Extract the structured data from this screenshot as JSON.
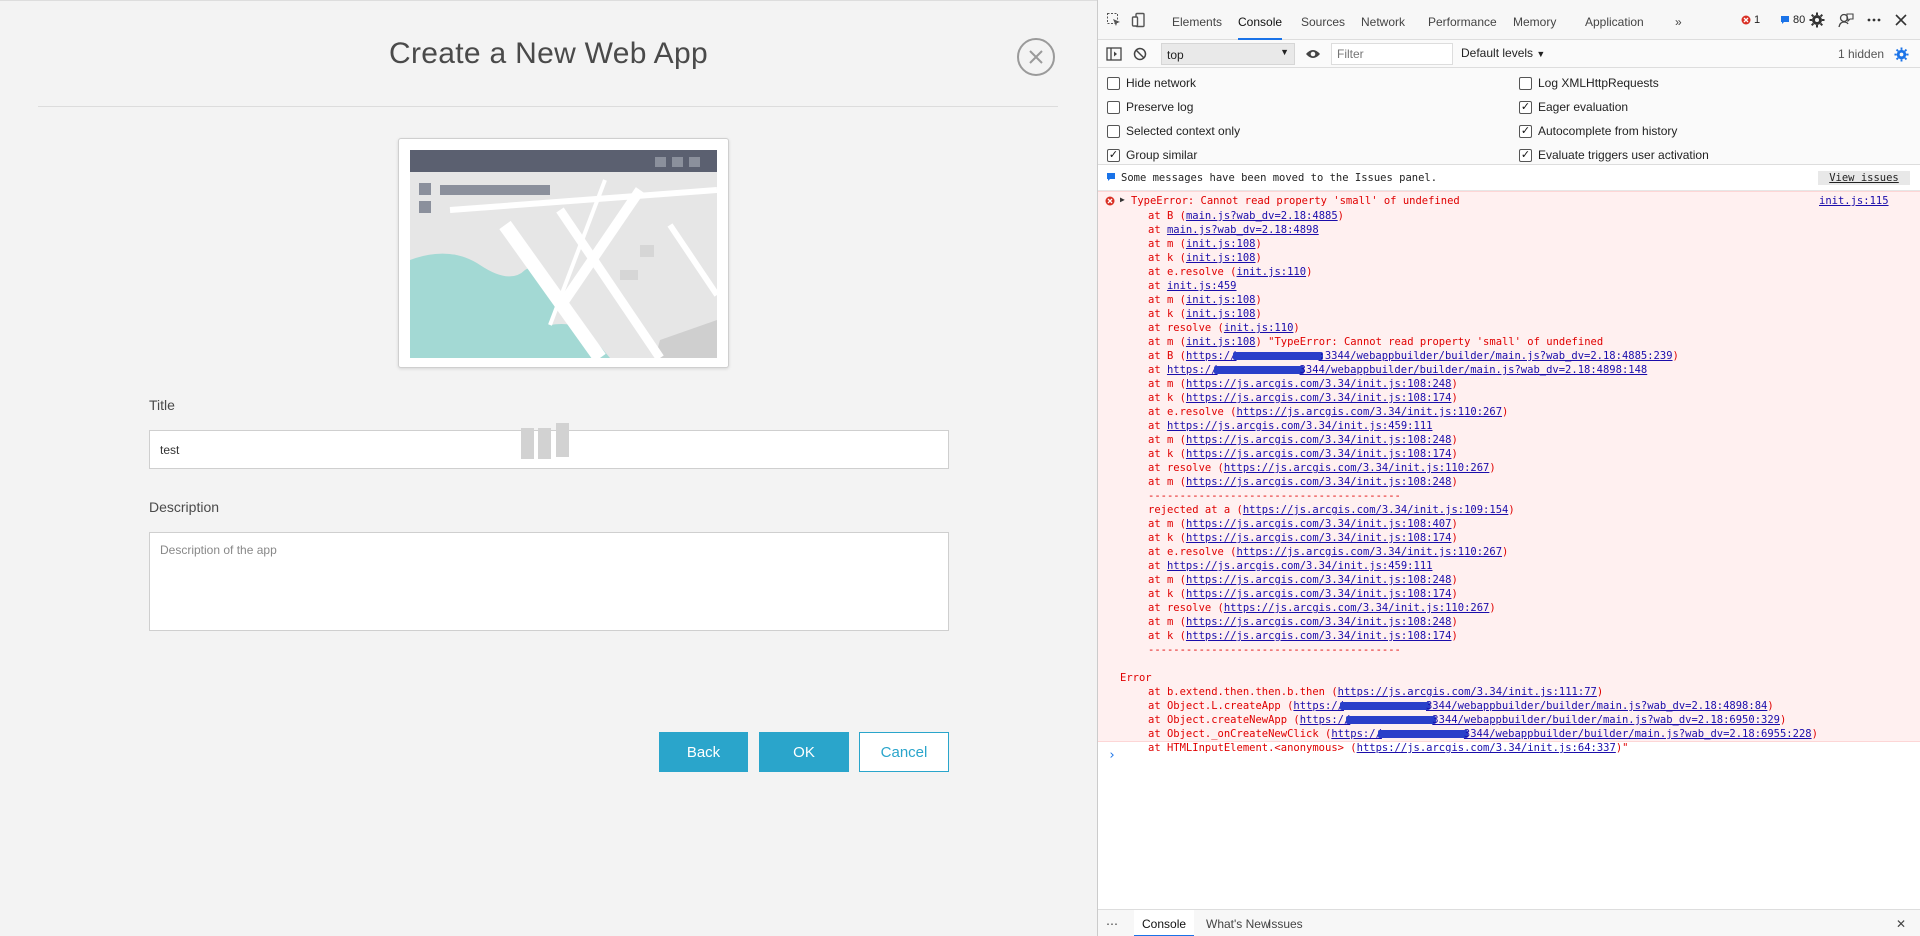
{
  "app": {
    "title": "Create a New Web App",
    "title_label": "Title",
    "title_value": "test",
    "description_label": "Description",
    "description_placeholder": "Description of the app",
    "buttons": {
      "back": "Back",
      "ok": "OK",
      "cancel": "Cancel"
    },
    "accent_color": "#2aa5cb"
  },
  "devtools": {
    "tabs": [
      {
        "label": "Elements",
        "active": false
      },
      {
        "label": "Console",
        "active": true
      },
      {
        "label": "Sources",
        "active": false
      },
      {
        "label": "Network",
        "active": false
      },
      {
        "label": "Performance",
        "active": false
      },
      {
        "label": "Memory",
        "active": false
      },
      {
        "label": "Application",
        "active": false
      }
    ],
    "more_tabs": "»",
    "error_count": "1",
    "message_count": "80",
    "context": "top",
    "filter_placeholder": "Filter",
    "levels": "Default levels",
    "hidden": "1 hidden",
    "settings": {
      "left": [
        {
          "label": "Hide network",
          "checked": false
        },
        {
          "label": "Preserve log",
          "checked": false
        },
        {
          "label": "Selected context only",
          "checked": false
        },
        {
          "label": "Group similar",
          "checked": true
        }
      ],
      "right": [
        {
          "label": "Log XMLHttpRequests",
          "checked": false
        },
        {
          "label": "Eager evaluation",
          "checked": true
        },
        {
          "label": "Autocomplete from history",
          "checked": true
        },
        {
          "label": "Evaluate triggers user activation",
          "checked": true
        }
      ]
    },
    "info_message": "Some messages have been moved to the Issues panel.",
    "view_issues": "View issues",
    "error_head": "TypeError: Cannot read property 'small' of undefined",
    "error_source": "init.js:115",
    "stack": [
      {
        "indent": 1,
        "pre": "at B (",
        "link": "main.js?wab_dv=2.18:4885",
        "post": ")"
      },
      {
        "indent": 1,
        "pre": "at ",
        "link": "main.js?wab_dv=2.18:4898",
        "post": ""
      },
      {
        "indent": 1,
        "pre": "at m (",
        "link": "init.js:108",
        "post": ")"
      },
      {
        "indent": 1,
        "pre": "at k (",
        "link": "init.js:108",
        "post": ")"
      },
      {
        "indent": 1,
        "pre": "at e.resolve (",
        "link": "init.js:110",
        "post": ")"
      },
      {
        "indent": 1,
        "pre": "at ",
        "link": "init.js:459",
        "post": ""
      },
      {
        "indent": 1,
        "pre": "at m (",
        "link": "init.js:108",
        "post": ")"
      },
      {
        "indent": 1,
        "pre": "at k (",
        "link": "init.js:108",
        "post": ")"
      },
      {
        "indent": 1,
        "pre": "at resolve (",
        "link": "init.js:110",
        "post": ")"
      },
      {
        "indent": 1,
        "pre": "at m (",
        "link": "init.js:108",
        "post": ") \"TypeError: Cannot read property 'small' of undefined"
      },
      {
        "indent": 1,
        "pre": "at B (",
        "link": "https://",
        "redact": true,
        "link2": ":3344/webappbuilder/builder/main.js?wab_dv=2.18:4885:239",
        "post": ")"
      },
      {
        "indent": 1,
        "pre": "at ",
        "link": "https://",
        "redact": true,
        "link2": "3344/webappbuilder/builder/main.js?wab_dv=2.18:4898:148",
        "post": ""
      },
      {
        "indent": 1,
        "pre": "at m (",
        "link": "https://js.arcgis.com/3.34/init.js:108:248",
        "post": ")"
      },
      {
        "indent": 1,
        "pre": "at k (",
        "link": "https://js.arcgis.com/3.34/init.js:108:174",
        "post": ")"
      },
      {
        "indent": 1,
        "pre": "at e.resolve (",
        "link": "https://js.arcgis.com/3.34/init.js:110:267",
        "post": ")"
      },
      {
        "indent": 1,
        "pre": "at ",
        "link": "https://js.arcgis.com/3.34/init.js:459:111",
        "post": ""
      },
      {
        "indent": 1,
        "pre": "at m (",
        "link": "https://js.arcgis.com/3.34/init.js:108:248",
        "post": ")"
      },
      {
        "indent": 1,
        "pre": "at k (",
        "link": "https://js.arcgis.com/3.34/init.js:108:174",
        "post": ")"
      },
      {
        "indent": 1,
        "pre": "at resolve (",
        "link": "https://js.arcgis.com/3.34/init.js:110:267",
        "post": ")"
      },
      {
        "indent": 1,
        "pre": "at m (",
        "link": "https://js.arcgis.com/3.34/init.js:108:248",
        "post": ")"
      },
      {
        "indent": 1,
        "pre": "----------------------------------------",
        "link": "",
        "post": ""
      },
      {
        "indent": 1,
        "pre": "rejected at a (",
        "link": "https://js.arcgis.com/3.34/init.js:109:154",
        "post": ")"
      },
      {
        "indent": 1,
        "pre": "at m (",
        "link": "https://js.arcgis.com/3.34/init.js:108:407",
        "post": ")"
      },
      {
        "indent": 1,
        "pre": "at k (",
        "link": "https://js.arcgis.com/3.34/init.js:108:174",
        "post": ")"
      },
      {
        "indent": 1,
        "pre": "at e.resolve (",
        "link": "https://js.arcgis.com/3.34/init.js:110:267",
        "post": ")"
      },
      {
        "indent": 1,
        "pre": "at ",
        "link": "https://js.arcgis.com/3.34/init.js:459:111",
        "post": ""
      },
      {
        "indent": 1,
        "pre": "at m (",
        "link": "https://js.arcgis.com/3.34/init.js:108:248",
        "post": ")"
      },
      {
        "indent": 1,
        "pre": "at k (",
        "link": "https://js.arcgis.com/3.34/init.js:108:174",
        "post": ")"
      },
      {
        "indent": 1,
        "pre": "at resolve (",
        "link": "https://js.arcgis.com/3.34/init.js:110:267",
        "post": ")"
      },
      {
        "indent": 1,
        "pre": "at m (",
        "link": "https://js.arcgis.com/3.34/init.js:108:248",
        "post": ")"
      },
      {
        "indent": 1,
        "pre": "at k (",
        "link": "https://js.arcgis.com/3.34/init.js:108:174",
        "post": ")"
      },
      {
        "indent": 1,
        "pre": "----------------------------------------",
        "link": "",
        "post": ""
      },
      {
        "indent": 0,
        "pre": "",
        "link": "",
        "post": ""
      },
      {
        "indent": 0,
        "pre": "Error",
        "link": "",
        "post": ""
      },
      {
        "indent": 1,
        "pre": "at b.extend.then.then.b.then (",
        "link": "https://js.arcgis.com/3.34/init.js:111:77",
        "post": ")"
      },
      {
        "indent": 1,
        "pre": "at Object.L.createApp (",
        "link": "https://",
        "redact": true,
        "link2": "3344/webappbuilder/builder/main.js?wab_dv=2.18:4898:84",
        "post": ")"
      },
      {
        "indent": 1,
        "pre": "at Object.createNewApp (",
        "link": "https://",
        "redact": true,
        "link2": "3344/webappbuilder/builder/main.js?wab_dv=2.18:6950:329",
        "post": ")"
      },
      {
        "indent": 1,
        "pre": "at Object._onCreateNewClick (",
        "link": "https://",
        "redact": true,
        "link2": "3344/webappbuilder/builder/main.js?wab_dv=2.18:6955:228",
        "post": ")"
      },
      {
        "indent": 1,
        "pre": "at HTMLInputElement.<anonymous> (",
        "link": "https://js.arcgis.com/3.34/init.js:64:337",
        "post": ")\""
      }
    ],
    "prompt": "›",
    "drawer": {
      "more": "⋯",
      "tabs": [
        {
          "label": "Console",
          "active": true
        },
        {
          "label": "What's New",
          "active": false
        },
        {
          "label": "Issues",
          "active": false
        }
      ],
      "close": "✕"
    },
    "icons": [
      "inspect-icon",
      "device-icon",
      "settings-icon",
      "feedback-icon",
      "more-icon",
      "close-icon",
      "sidebar-icon",
      "clear-icon",
      "eye-icon",
      "settings-gear-icon"
    ]
  }
}
